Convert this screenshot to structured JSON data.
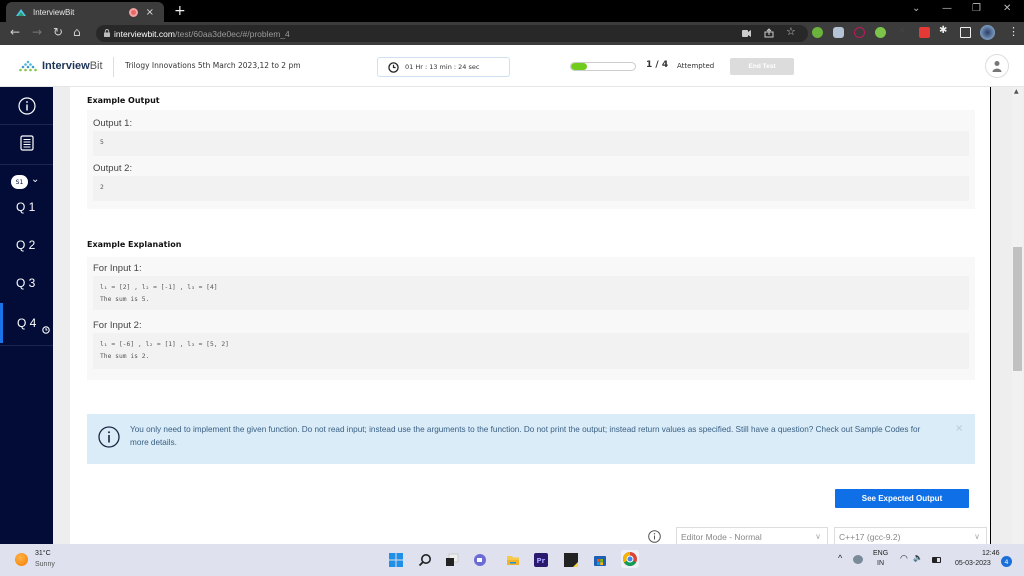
{
  "browser": {
    "tab_title": "InterviewBit",
    "tab_close": "×",
    "new_tab": "+",
    "url_domain": "interviewbit.com",
    "url_path": "/test/60aa3de0ec/#/problem_4",
    "window_controls": {
      "dropdown": "⌄",
      "minimize": "—",
      "restore": "❐",
      "close": "✕"
    },
    "nav": {
      "back": "←",
      "forward": "→",
      "reload": "↻",
      "home": "⌂"
    }
  },
  "header": {
    "logo_bold": "Interview",
    "logo_light": "Bit",
    "test_title": "Trilogy Innovations 5th March 2023,12 to 2 pm",
    "timer": "01 Hr : 13 min : 24 sec",
    "progress_fraction": 0.25,
    "attempt_count": "1 / 4",
    "attempt_label": "Attempted",
    "end_test_label": "End Test"
  },
  "sidebar": {
    "section_badge": "S1",
    "questions": [
      {
        "label": "Q 1",
        "active": false
      },
      {
        "label": "Q 2",
        "active": false
      },
      {
        "label": "Q 3",
        "active": false
      },
      {
        "label": "Q 4",
        "active": true
      }
    ]
  },
  "main": {
    "example_output": {
      "title": "Example Output",
      "items": [
        {
          "label": "Output 1:",
          "code": "5"
        },
        {
          "label": "Output 2:",
          "code": "2"
        }
      ]
    },
    "example_explanation": {
      "title": "Example Explanation",
      "items": [
        {
          "label": "For Input 1:",
          "code": "l₁ = [2] , l₂ = [-1] , l₃ = [4]\nThe sum is 5."
        },
        {
          "label": "For Input 2:",
          "code": "l₁ = [-6] , l₂ = [1] , l₃ = [5, 2]\nThe sum is 2."
        }
      ]
    },
    "alert": {
      "text": "You only need to implement the given function. Do not read input; instead use the arguments to the function. Do not print the output; instead return values as specified. Still have a question? Check out Sample Codes for more details.",
      "close": "×"
    },
    "see_expected_output_label": "See Expected Output",
    "editor_mode": "Editor Mode - Normal",
    "language": "C++17 (gcc-9.2)"
  },
  "taskbar": {
    "weather_temp": "31°C",
    "weather_desc": "Sunny",
    "lang_top": "ENG",
    "lang_bottom": "IN",
    "time": "12:46",
    "date": "05-03-2023",
    "notification_count": "4",
    "tray_chevron": "^"
  }
}
